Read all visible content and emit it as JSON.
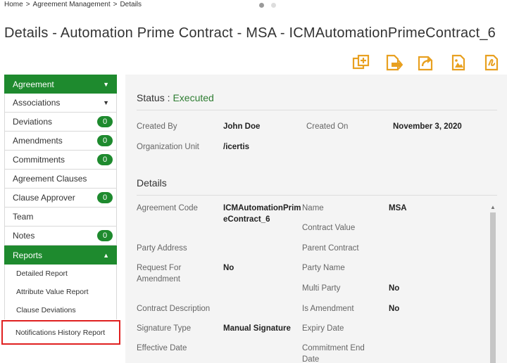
{
  "breadcrumb": [
    "Home",
    ">",
    "Agreement Management",
    ">",
    "Details"
  ],
  "title": "Details - Automation Prime Contract - MSA - ICMAutomationPrimeContract_6",
  "toolbar": [
    "copy-agreement-icon",
    "export-document-icon",
    "share-icon",
    "image-icon",
    "sign-document-icon"
  ],
  "sidebar": {
    "agreement": "Agreement",
    "items": [
      {
        "label": "Associations",
        "badge": null
      },
      {
        "label": "Deviations",
        "badge": "0"
      },
      {
        "label": "Amendments",
        "badge": "0"
      },
      {
        "label": "Commitments",
        "badge": "0"
      },
      {
        "label": "Agreement Clauses",
        "badge": null
      },
      {
        "label": "Clause Approver",
        "badge": "0"
      },
      {
        "label": "Team",
        "badge": null
      },
      {
        "label": "Notes",
        "badge": "0"
      }
    ],
    "reports": "Reports",
    "report_items": [
      "Detailed Report",
      "Attribute Value Report",
      "Clause Deviations",
      "Notifications History Report"
    ]
  },
  "status": {
    "label": "Status :",
    "value": "Executed"
  },
  "meta": {
    "created_by_label": "Created By",
    "created_by": "John Doe",
    "created_on_label": "Created On",
    "created_on": "November 3, 2020",
    "org_unit_label": "Organization Unit",
    "org_unit": "/icertis"
  },
  "details": {
    "heading": "Details",
    "agreement_code_label": "Agreement Code",
    "agreement_code_1": "ICMAutomationPrim",
    "agreement_code_2": "eContract_6",
    "name_label": "Name",
    "name": "MSA",
    "contract_value_label": "Contract Value",
    "party_address_label": "Party Address",
    "parent_contract_label": "Parent Contract",
    "request_amend_label_1": "Request For",
    "request_amend_label_2": "Amendment",
    "request_amend": "No",
    "party_name_label": "Party Name",
    "multi_party_label": "Multi Party",
    "multi_party": "No",
    "contract_desc_label": "Contract Description",
    "is_amendment_label": "Is Amendment",
    "is_amendment": "No",
    "signature_type_label": "Signature Type",
    "signature_type": "Manual Signature",
    "expiry_date_label": "Expiry Date",
    "effective_date_label": "Effective Date",
    "commitment_end_label_1": "Commitment End",
    "commitment_end_label_2": "Date"
  },
  "colors": {
    "accent": "#1e8a2e",
    "status": "#2e7d32",
    "highlight": "#e02020",
    "icon": "#e8a020"
  }
}
